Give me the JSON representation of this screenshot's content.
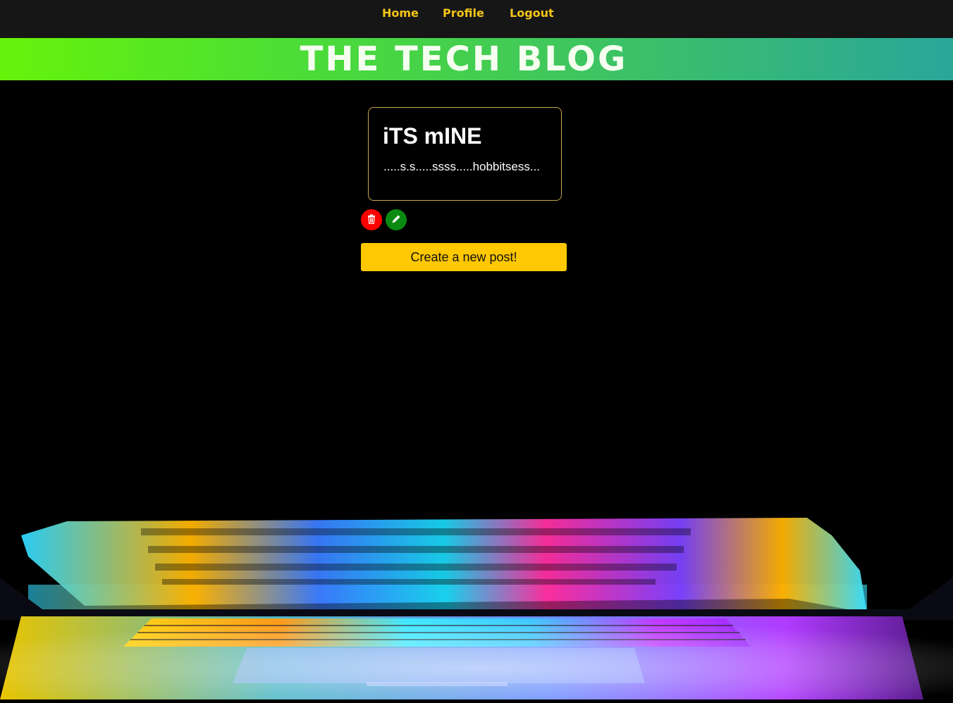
{
  "nav": {
    "home": "Home",
    "profile": "Profile",
    "logout": "Logout"
  },
  "banner": {
    "title": "THE TECH BLOG"
  },
  "post": {
    "title": "iTS mINE",
    "body": ".....s.s.....ssss.....hobbitsess..."
  },
  "actions": {
    "delete_icon": "trash-icon",
    "edit_icon": "pencil-icon",
    "create_label": "Create a new post!"
  },
  "colors": {
    "nav_bg": "#161616",
    "nav_link": "#f5c518",
    "banner_start": "#66f30b",
    "banner_end": "#2aa69a",
    "card_border": "#c9a648",
    "delete": "#ff0000",
    "edit": "#0a8a12",
    "create_button": "#ffc800"
  }
}
